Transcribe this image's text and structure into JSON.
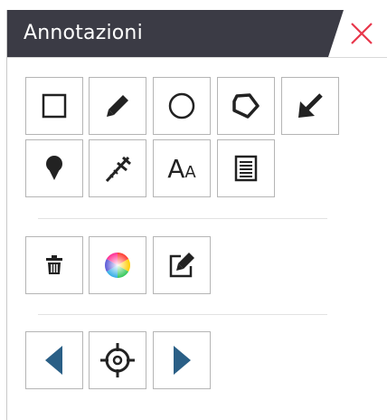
{
  "panel": {
    "title": "Annotazioni",
    "close_icon": "close-icon",
    "accent_color": "#e8364b",
    "header_color": "#3b3b45"
  },
  "tools": [
    {
      "name": "rectangle-tool",
      "icon": "square-icon"
    },
    {
      "name": "pencil-tool",
      "icon": "pencil-icon"
    },
    {
      "name": "circle-tool",
      "icon": "circle-icon"
    },
    {
      "name": "polygon-tool",
      "icon": "polygon-icon"
    },
    {
      "name": "arrow-tool",
      "icon": "arrow-down-left-icon"
    },
    {
      "name": "pin-tool",
      "icon": "map-pin-icon"
    },
    {
      "name": "measure-tool",
      "icon": "caliper-icon"
    },
    {
      "name": "text-tool",
      "icon": "text-size-icon",
      "label": "AA"
    },
    {
      "name": "note-tool",
      "icon": "document-icon"
    }
  ],
  "actions": [
    {
      "name": "delete",
      "icon": "trash-icon"
    },
    {
      "name": "color",
      "icon": "color-wheel-icon"
    },
    {
      "name": "edit",
      "icon": "edit-icon"
    }
  ],
  "navigation": [
    {
      "name": "previous",
      "icon": "triangle-left-icon"
    },
    {
      "name": "center",
      "icon": "crosshair-icon"
    },
    {
      "name": "next",
      "icon": "triangle-right-icon"
    }
  ]
}
